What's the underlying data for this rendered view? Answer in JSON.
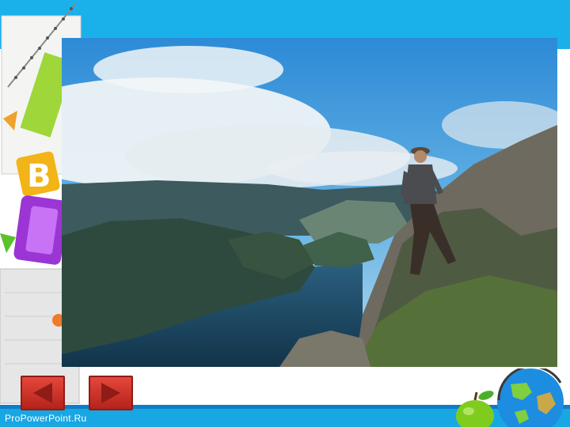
{
  "slide": {
    "watermark": "ProPowerPoint.Ru",
    "photo_subject": "hiker-on-cliff-fjord-photo"
  },
  "navigation": {
    "prev_icon": "triangle-left-icon",
    "next_icon": "triangle-right-icon"
  },
  "colors": {
    "header_blue": "#1ab0ea",
    "footer_blue": "#17a7e3",
    "button_red": "#d3362c"
  },
  "decorations": {
    "letter_b": "B"
  }
}
